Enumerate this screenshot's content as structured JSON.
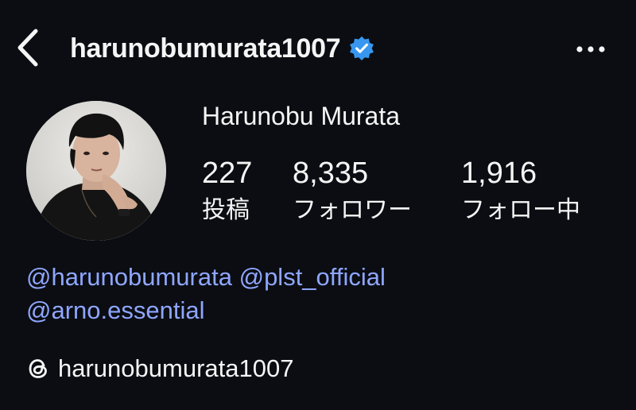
{
  "header": {
    "username": "harunobumurata1007",
    "verified": true,
    "verified_color": "#3797f0"
  },
  "profile": {
    "display_name": "Harunobu Murata",
    "stats": {
      "posts": {
        "value": "227",
        "label": "投稿"
      },
      "followers": {
        "value": "8,335",
        "label": "フォロワー"
      },
      "following": {
        "value": "1,916",
        "label": "フォロー中"
      }
    },
    "bio_mentions": [
      "@harunobumurata",
      "@plst_official",
      "@arno.essential"
    ],
    "threads_handle": "harunobumurata1007"
  },
  "colors": {
    "background": "#0b0d12",
    "text": "#f5f5f5",
    "link": "#8fa6ff"
  },
  "icons": [
    "back-chevron-icon",
    "verified-badge-icon",
    "more-options-icon",
    "threads-icon"
  ]
}
